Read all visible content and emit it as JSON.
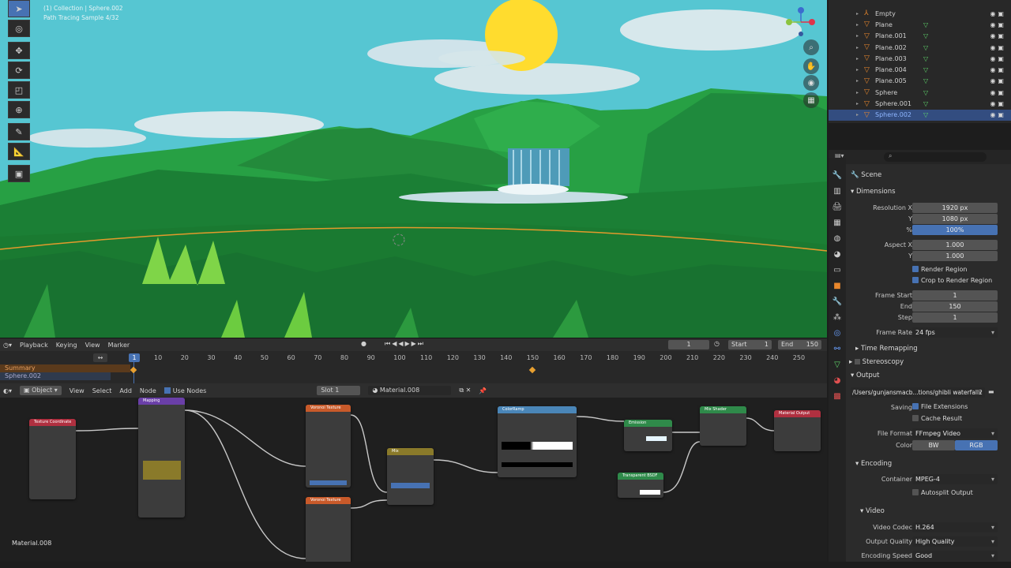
{
  "viewport": {
    "info_line1": "(1) Collection | Sphere.002",
    "info_line2": "Path Tracing Sample 4/32"
  },
  "outliner": {
    "items": [
      {
        "name": "Empty",
        "selected": false
      },
      {
        "name": "Plane",
        "selected": false
      },
      {
        "name": "Plane.001",
        "selected": false
      },
      {
        "name": "Plane.002",
        "selected": false
      },
      {
        "name": "Plane.003",
        "selected": false
      },
      {
        "name": "Plane.004",
        "selected": false
      },
      {
        "name": "Plane.005",
        "selected": false
      },
      {
        "name": "Sphere",
        "selected": false
      },
      {
        "name": "Sphere.001",
        "selected": false
      },
      {
        "name": "Sphere.002",
        "selected": true
      }
    ]
  },
  "properties": {
    "scene_label": "Scene",
    "dimensions": "Dimensions",
    "resolution_x_label": "Resolution X",
    "resolution_x": "1920 px",
    "resolution_y_label": "Y",
    "resolution_y": "1080 px",
    "percent_label": "%",
    "percent": "100%",
    "aspect_x_label": "Aspect X",
    "aspect_x": "1.000",
    "aspect_y_label": "Y",
    "aspect_y": "1.000",
    "render_region": "Render Region",
    "crop_region": "Crop to Render Region",
    "frame_start_label": "Frame Start",
    "frame_start": "1",
    "frame_end_label": "End",
    "frame_end": "150",
    "frame_step_label": "Step",
    "frame_step": "1",
    "frame_rate_label": "Frame Rate",
    "frame_rate": "24 fps",
    "time_remapping": "Time Remapping",
    "stereoscopy": "Stereoscopy",
    "output": "Output",
    "output_path": "/Users/gunjansmacb...tions/ghibli waterfall2",
    "saving_label": "Saving",
    "file_extensions": "File Extensions",
    "cache_result": "Cache Result",
    "file_format_label": "File Format",
    "file_format": "FFmpeg Video",
    "color_label": "Color",
    "color_bw": "BW",
    "color_rgb": "RGB",
    "encoding": "Encoding",
    "container_label": "Container",
    "container": "MPEG-4",
    "autosplit": "Autosplit Output",
    "video": "Video",
    "video_codec_label": "Video Codec",
    "video_codec": "H.264",
    "output_quality_label": "Output Quality",
    "output_quality": "High Quality",
    "encoding_speed_label": "Encoding Speed",
    "encoding_speed": "Good"
  },
  "timeline": {
    "menu_playback": "Playback",
    "menu_keying": "Keying",
    "menu_view": "View",
    "menu_marker": "Marker",
    "current_frame": "1",
    "start_label": "Start",
    "start": "1",
    "end_label": "End",
    "end": "150",
    "summary": "Summary",
    "object_row": "Sphere.002",
    "ticks": [
      "10",
      "20",
      "30",
      "40",
      "50",
      "60",
      "70",
      "80",
      "90",
      "100",
      "110",
      "120",
      "130",
      "140",
      "150",
      "160",
      "170",
      "180",
      "190",
      "200",
      "210",
      "220",
      "230",
      "240",
      "250"
    ]
  },
  "node_editor": {
    "mode": "Object",
    "menu_view": "View",
    "menu_select": "Select",
    "menu_add": "Add",
    "menu_node": "Node",
    "use_nodes": "Use Nodes",
    "slot": "Slot 1",
    "material": "Material.008",
    "material_label": "Material.008",
    "nodes": {
      "texcoord": "Texture Coordinate",
      "mapping": "Mapping",
      "voronoi1": "Voronoi Texture",
      "voronoi2": "Voronoi Texture",
      "mix": "Mix",
      "colorramp": "ColorRamp",
      "emission": "Emission",
      "transparent": "Transparent BSDF",
      "mixshader": "Mix Shader",
      "output": "Material Output"
    }
  }
}
